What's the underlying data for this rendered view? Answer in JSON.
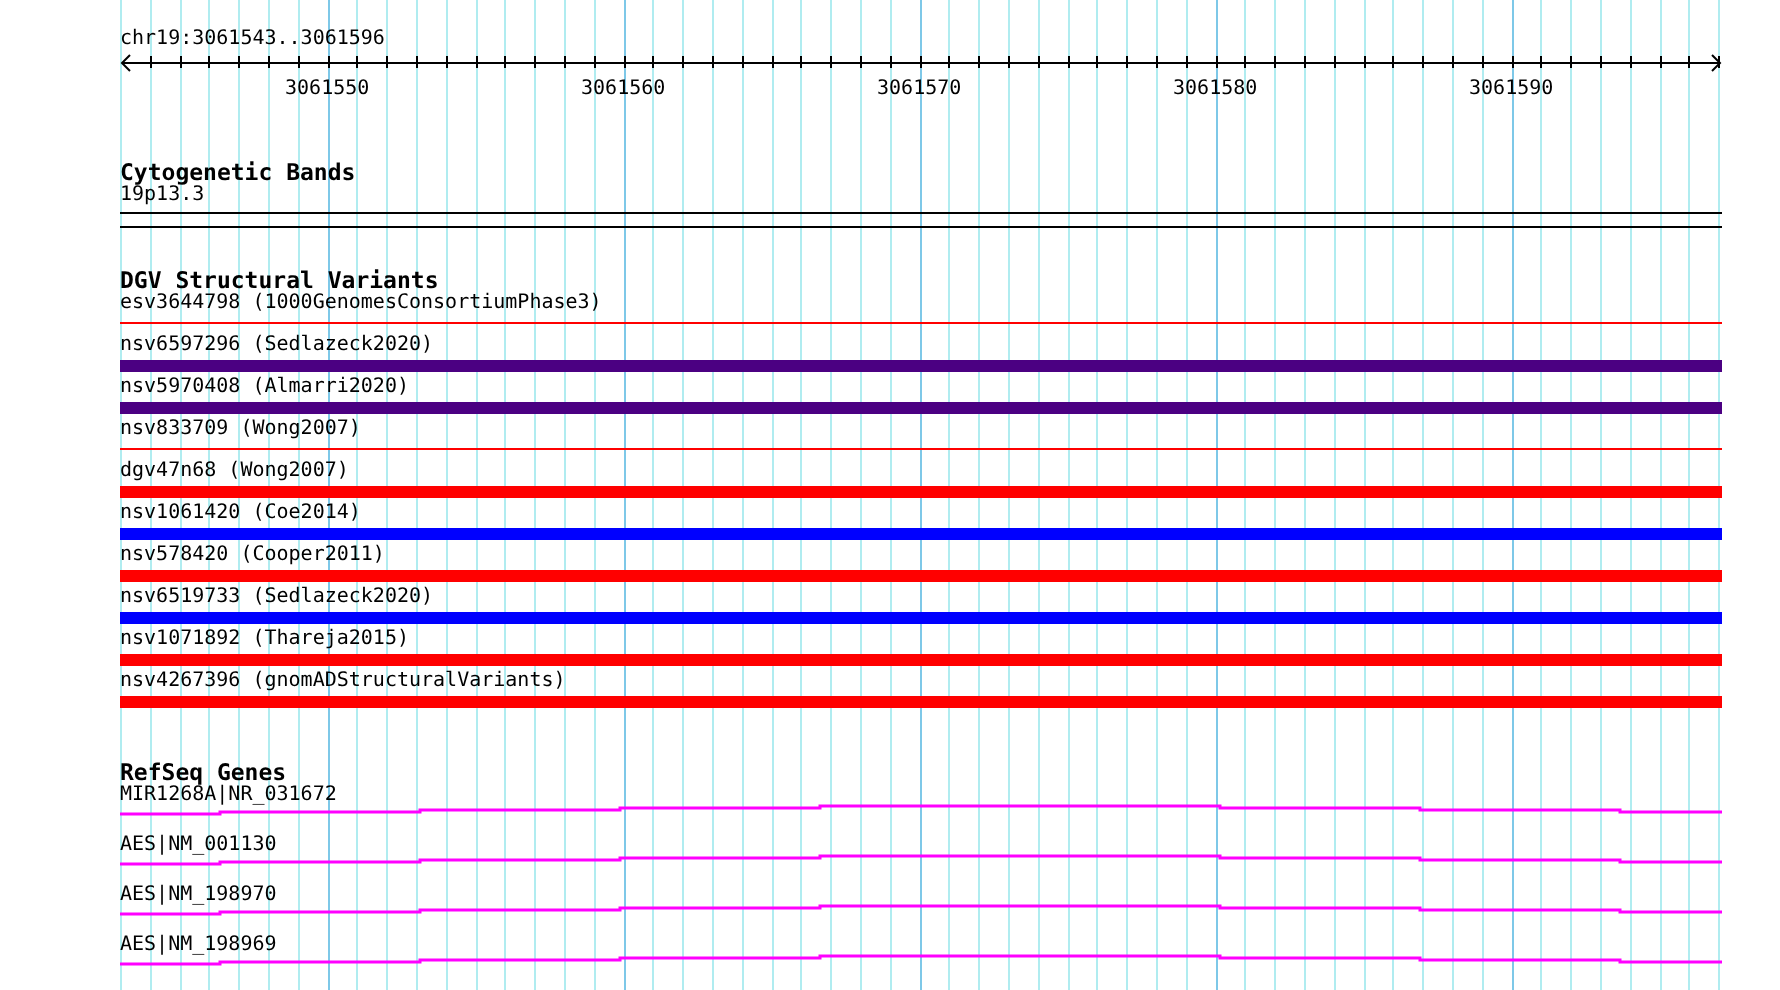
{
  "location": "chr19:3061543..3061596",
  "ruler": {
    "ticks": [
      "3061550",
      "3061560",
      "3061570",
      "3061580",
      "3061590"
    ]
  },
  "tracks": [
    {
      "kind": "cytoband",
      "title": "Cytogenetic Bands",
      "features": [
        {
          "label": "19p13.3"
        }
      ]
    },
    {
      "kind": "variants",
      "title": "DGV Structural Variants",
      "features": [
        {
          "label": "esv3644798 (1000GenomesConsortiumPhase3)",
          "kind": "line",
          "color": "#ff0000"
        },
        {
          "label": "nsv6597296 (Sedlazeck2020)",
          "kind": "bar",
          "color": "#4b0082"
        },
        {
          "label": "nsv5970408 (Almarri2020)",
          "kind": "bar",
          "color": "#4b0082"
        },
        {
          "label": "nsv833709 (Wong2007)",
          "kind": "line",
          "color": "#ff0000"
        },
        {
          "label": "dgv47n68 (Wong2007)",
          "kind": "bar",
          "color": "#ff0000"
        },
        {
          "label": "nsv1061420 (Coe2014)",
          "kind": "bar",
          "color": "#0000ff"
        },
        {
          "label": "nsv578420 (Cooper2011)",
          "kind": "bar",
          "color": "#ff0000"
        },
        {
          "label": "nsv6519733 (Sedlazeck2020)",
          "kind": "bar",
          "color": "#0000ff"
        },
        {
          "label": "nsv1071892 (Thareja2015)",
          "kind": "bar",
          "color": "#ff0000"
        },
        {
          "label": "nsv4267396 (gnomADStructuralVariants)",
          "kind": "bar",
          "color": "#ff0000"
        }
      ]
    },
    {
      "kind": "genes",
      "title": "RefSeq Genes",
      "features": [
        {
          "label": "MIR1268A|NR_031672"
        },
        {
          "label": "AES|NM_001130"
        },
        {
          "label": "AES|NM_198970"
        },
        {
          "label": "AES|NM_198969"
        }
      ]
    }
  ]
}
